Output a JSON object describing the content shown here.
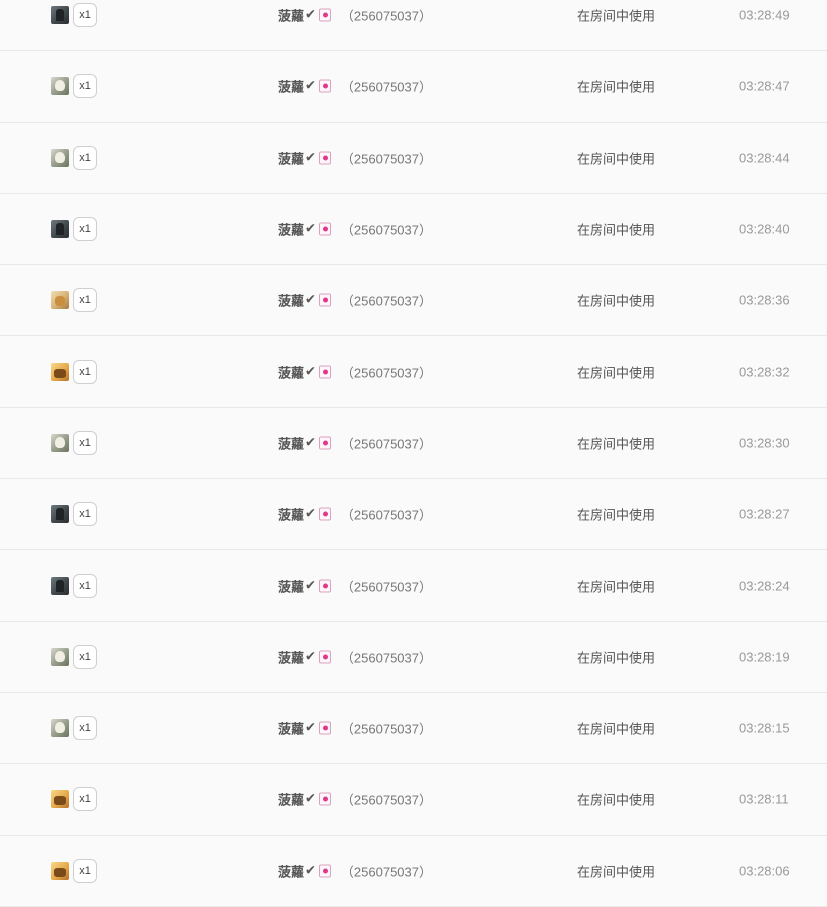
{
  "rows": [
    {
      "icon": "dark",
      "gift_icon_name": "dark-figure-gift-icon",
      "count": "x1",
      "user": "菠蘿",
      "verify_glyph": "✔",
      "user_id": "（256075037）",
      "usage": "在房间中使用",
      "time": "03:28:49"
    },
    {
      "icon": "grey",
      "gift_icon_name": "white-animal-gift-icon",
      "count": "x1",
      "user": "菠蘿",
      "verify_glyph": "✔",
      "user_id": "（256075037）",
      "usage": "在房间中使用",
      "time": "03:28:47"
    },
    {
      "icon": "grey",
      "gift_icon_name": "white-animal-gift-icon",
      "count": "x1",
      "user": "菠蘿",
      "verify_glyph": "✔",
      "user_id": "（256075037）",
      "usage": "在房间中使用",
      "time": "03:28:44"
    },
    {
      "icon": "dark",
      "gift_icon_name": "dark-figure-gift-icon",
      "count": "x1",
      "user": "菠蘿",
      "verify_glyph": "✔",
      "user_id": "（256075037）",
      "usage": "在房间中使用",
      "time": "03:28:40"
    },
    {
      "icon": "tan",
      "gift_icon_name": "tan-animal-gift-icon",
      "count": "x1",
      "user": "菠蘿",
      "verify_glyph": "✔",
      "user_id": "（256075037）",
      "usage": "在房间中使用",
      "time": "03:28:36"
    },
    {
      "icon": "gold",
      "gift_icon_name": "gold-animal-gift-icon",
      "count": "x1",
      "user": "菠蘿",
      "verify_glyph": "✔",
      "user_id": "（256075037）",
      "usage": "在房间中使用",
      "time": "03:28:32"
    },
    {
      "icon": "grey",
      "gift_icon_name": "white-animal-gift-icon",
      "count": "x1",
      "user": "菠蘿",
      "verify_glyph": "✔",
      "user_id": "（256075037）",
      "usage": "在房间中使用",
      "time": "03:28:30"
    },
    {
      "icon": "dark",
      "gift_icon_name": "dark-figure-gift-icon",
      "count": "x1",
      "user": "菠蘿",
      "verify_glyph": "✔",
      "user_id": "（256075037）",
      "usage": "在房间中使用",
      "time": "03:28:27"
    },
    {
      "icon": "dark",
      "gift_icon_name": "dark-figure-gift-icon",
      "count": "x1",
      "user": "菠蘿",
      "verify_glyph": "✔",
      "user_id": "（256075037）",
      "usage": "在房间中使用",
      "time": "03:28:24"
    },
    {
      "icon": "grey",
      "gift_icon_name": "white-animal-gift-icon",
      "count": "x1",
      "user": "菠蘿",
      "verify_glyph": "✔",
      "user_id": "（256075037）",
      "usage": "在房间中使用",
      "time": "03:28:19"
    },
    {
      "icon": "grey",
      "gift_icon_name": "white-animal-gift-icon",
      "count": "x1",
      "user": "菠蘿",
      "verify_glyph": "✔",
      "user_id": "（256075037）",
      "usage": "在房间中使用",
      "time": "03:28:15"
    },
    {
      "icon": "gold",
      "gift_icon_name": "gold-animal-gift-icon",
      "count": "x1",
      "user": "菠蘿",
      "verify_glyph": "✔",
      "user_id": "（256075037）",
      "usage": "在房间中使用",
      "time": "03:28:11"
    },
    {
      "icon": "gold",
      "gift_icon_name": "gold-animal-gift-icon",
      "count": "x1",
      "user": "菠蘿",
      "verify_glyph": "✔",
      "user_id": "（256075037）",
      "usage": "在房间中使用",
      "time": "03:28:06"
    }
  ]
}
